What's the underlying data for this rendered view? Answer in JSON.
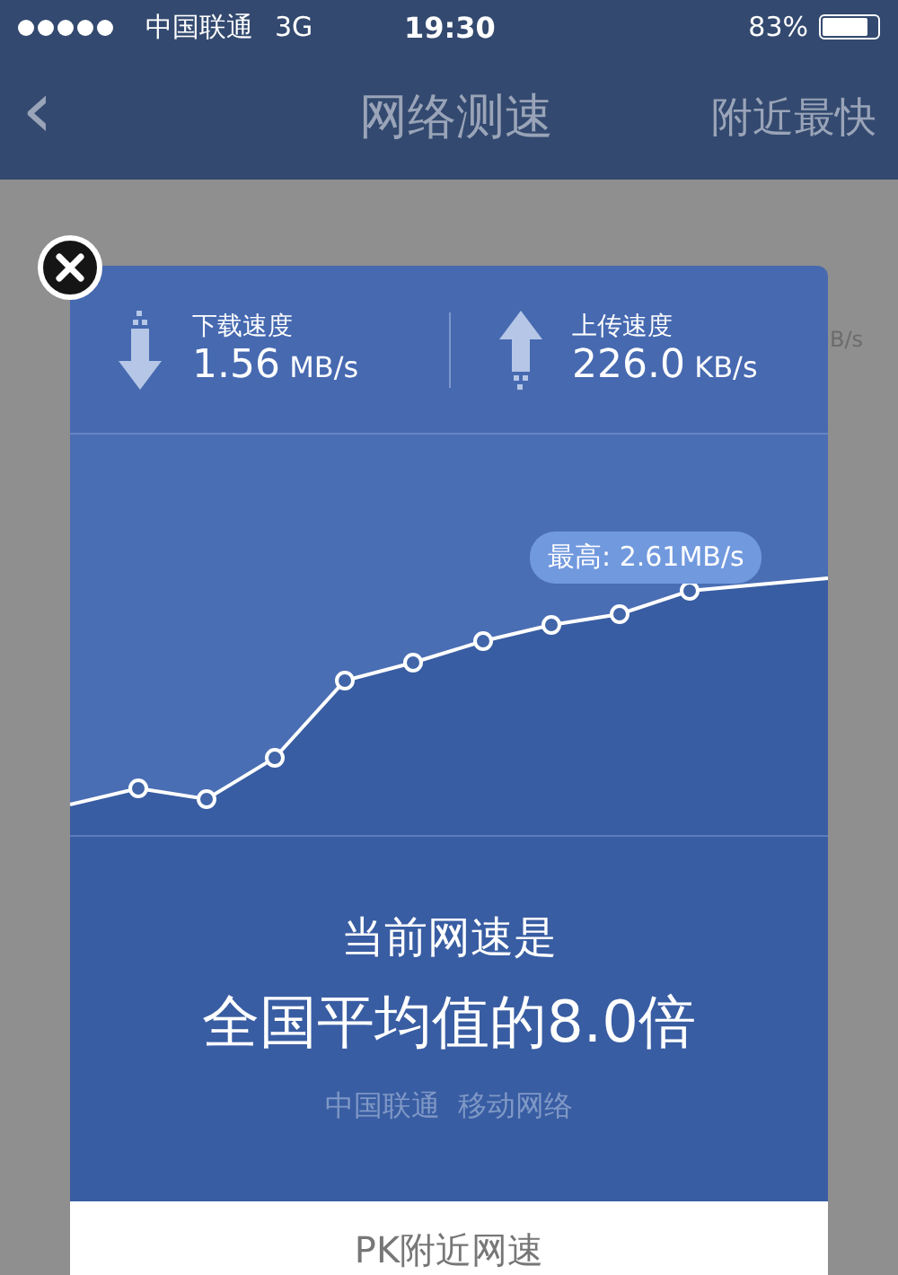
{
  "status_bar": {
    "carrier": "中国联通",
    "network": "3G",
    "time": "19:30",
    "battery": "83%"
  },
  "nav_bar": {
    "back": "‹",
    "title": "网络测速",
    "action": "附近最快"
  },
  "background": {
    "partial_text": "B/s"
  },
  "dialog": {
    "speeds": [
      {
        "kind": "download",
        "label": "下载速度",
        "value": "1.56",
        "unit": "MB/s"
      },
      {
        "kind": "upload",
        "label": "上传速度",
        "value": "226.0",
        "unit": "KB/s"
      }
    ],
    "peak_label": "最高: 2.61MB/s",
    "headline": "当前网速是",
    "result": "全国平均值的8.0倍",
    "network_info": "中国联通  移动网络",
    "button": "PK附近网速"
  }
}
